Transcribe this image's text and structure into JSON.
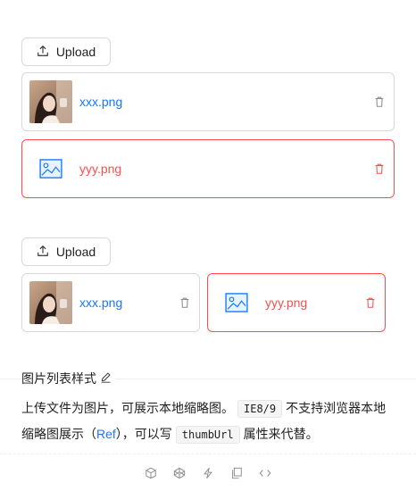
{
  "demo1": {
    "upload_label": "Upload",
    "files": [
      {
        "name": "xxx.png",
        "status": "done"
      },
      {
        "name": "yyy.png",
        "status": "error"
      }
    ]
  },
  "demo2": {
    "upload_label": "Upload",
    "files": [
      {
        "name": "xxx.png",
        "status": "done"
      },
      {
        "name": "yyy.png",
        "status": "error"
      }
    ]
  },
  "section": {
    "title": "图片列表样式",
    "desc_part1": "上传文件为图片，可展示本地缩略图。",
    "code1": "IE8/9",
    "desc_part2": "不支持浏览器本地缩略图展示（",
    "link": "Ref",
    "desc_part3": "），可以写",
    "code2": "thumbUrl",
    "desc_part4": "属性来代替。"
  },
  "icons": {
    "upload": "upload-icon",
    "delete": "delete-icon",
    "picture": "picture-icon",
    "edit": "edit-icon",
    "codesandbox": "codesandbox-icon",
    "codepen": "codepen-icon",
    "stackblitz": "thunderbolt-icon",
    "copy": "copy-icon",
    "code": "code-icon"
  },
  "colors": {
    "primary": "#1677ff",
    "error": "#ff4d4f",
    "border": "#d9d9d9"
  }
}
